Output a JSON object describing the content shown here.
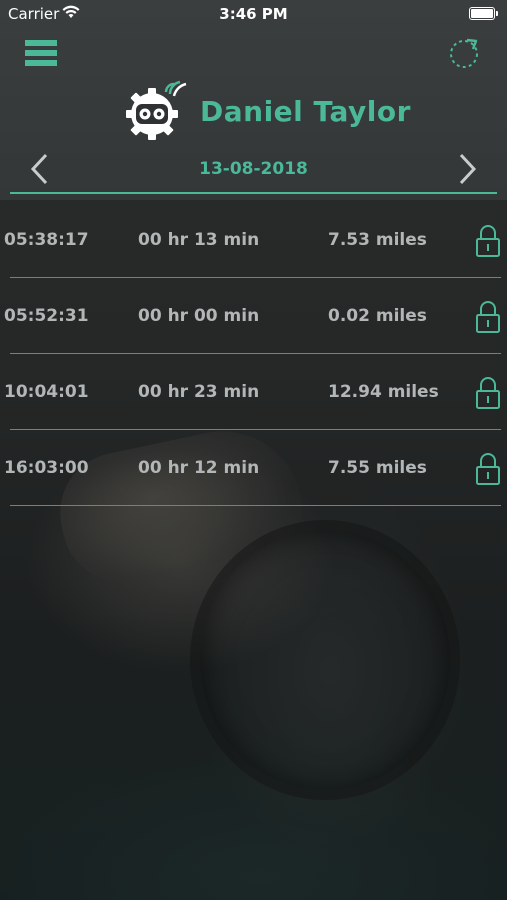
{
  "status_bar": {
    "carrier": "Carrier",
    "time": "3:46 PM"
  },
  "header": {
    "user_name": "Daniel Taylor",
    "date": "13-08-2018",
    "menu_icon": "hamburger-menu-icon",
    "refresh_icon": "refresh-icon",
    "prev_icon": "chevron-left-icon",
    "next_icon": "chevron-right-icon",
    "logo_icon": "gear-robot-logo-icon"
  },
  "trips": [
    {
      "time": "05:38:17",
      "duration": "00 hr 13 min",
      "distance": "7.53  miles",
      "lock_icon": "lock-icon"
    },
    {
      "time": "05:52:31",
      "duration": "00 hr 00 min",
      "distance": "0.02  miles",
      "lock_icon": "lock-icon"
    },
    {
      "time": "10:04:01",
      "duration": "00 hr 23 min",
      "distance": "12.94  miles",
      "lock_icon": "lock-icon"
    },
    {
      "time": "16:03:00",
      "duration": "00 hr 12 min",
      "distance": "7.55  miles",
      "lock_icon": "lock-icon"
    }
  ],
  "colors": {
    "accent": "#4bb898",
    "header_bg": "#363a3a",
    "text": "#b3b6b6",
    "divider": "#7a7e7e"
  }
}
